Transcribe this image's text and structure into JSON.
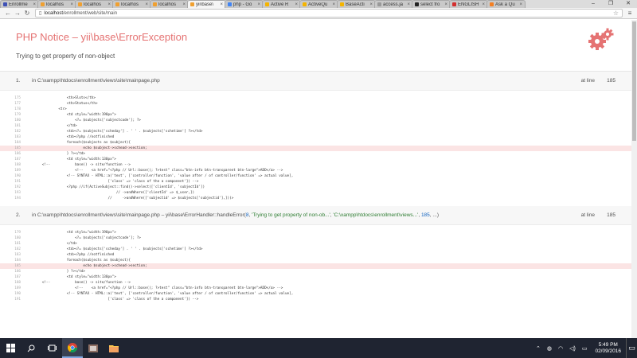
{
  "browser": {
    "tabs": [
      {
        "label": "Enrollme",
        "color": "#3f51b5",
        "active": false
      },
      {
        "label": "localhos",
        "color": "#f0a030",
        "active": false
      },
      {
        "label": "localhos",
        "color": "#f0a030",
        "active": false
      },
      {
        "label": "localhos",
        "color": "#f0a030",
        "active": false
      },
      {
        "label": "localhos",
        "color": "#f0a030",
        "active": false
      },
      {
        "label": "yii\\base\\",
        "color": "#f0a030",
        "active": true
      },
      {
        "label": "php - Go",
        "color": "#4285f4",
        "active": false
      },
      {
        "label": "Active R",
        "color": "#f5b400",
        "active": false
      },
      {
        "label": "ActiveQu",
        "color": "#f5b400",
        "active": false
      },
      {
        "label": "BaseActi",
        "color": "#f5b400",
        "active": false
      },
      {
        "label": "access.ja",
        "color": "#999999",
        "active": false
      },
      {
        "label": "select fro",
        "color": "#222222",
        "active": false
      },
      {
        "label": "ENGLISH",
        "color": "#d32f2f",
        "active": false
      },
      {
        "label": "Ask a Qu",
        "color": "#f48024",
        "active": false
      }
    ],
    "url_host": "localhost",
    "url_path": "/enrollment/web/site/main"
  },
  "error": {
    "type": "PHP Notice",
    "separator": " – ",
    "class": "yii\\base\\ErrorException",
    "message": "Trying to get property of non-object"
  },
  "calls": [
    {
      "num": "1.",
      "prefix": "in ",
      "file": "C:\\xampp\\htdocs\\enrollment\\views\\site\\mainpage.php",
      "fn": "",
      "args": [],
      "at_line_label": "at line",
      "line": "185",
      "code": [
        {
          "ln": "175",
          "text": "                    <th>Slots</th>",
          "err": false
        },
        {
          "ln": "177",
          "text": "                    <th>Status</th>",
          "err": false
        },
        {
          "ln": "178",
          "text": "                <tr>",
          "err": false
        },
        {
          "ln": "179",
          "text": "                    <td style=\"width:190px\">",
          "err": false
        },
        {
          "ln": "180",
          "text": "                        <?= $subjects['subjectcode']; ?>",
          "err": false
        },
        {
          "ln": "181",
          "text": "                    </td>",
          "err": false
        },
        {
          "ln": "182",
          "text": "                    <td><?= $subjects['scheday'] . ' ' . $subjects['schetime'] ?></td>",
          "err": false
        },
        {
          "ln": "183",
          "text": "                    <td><?php //notfinished",
          "err": false
        },
        {
          "ln": "184",
          "text": "                    foreach($subjects as $subject){",
          "err": false
        },
        {
          "ln": "185",
          "text": "                            echo $subject->schead->section;",
          "err": true
        },
        {
          "ln": "186",
          "text": "                    } ?></td>",
          "err": false
        },
        {
          "ln": "187",
          "text": "                    <td style=\"width:130px\">",
          "err": false
        },
        {
          "ln": "188",
          "text": "        <!--            base() -> site/function -->",
          "err": false
        },
        {
          "ln": "189",
          "text": "                        <!--    <a href=\"<?php // Url::base(); ?>test\" class=\"btn-info btn-transparent btn-large\">ADD</a> -->",
          "err": false
        },
        {
          "ln": "190",
          "text": "                    <!-- SYNTAX - HTML::a('text', ['controller/function', 'value after / of controller/function' => actual value],",
          "err": false
        },
        {
          "ln": "191",
          "text": "                                        ['class' => 'class of the a component']) -->",
          "err": false
        },
        {
          "ln": "192",
          "text": "                    <?php //if(ActiveSubject::find()->select(['clientId', 'subjectId'])",
          "err": false
        },
        {
          "ln": "193",
          "text": "                                            // ->andWhere(['clientId' => $_user,])",
          "err": false
        },
        {
          "ln": "194",
          "text": "                                        //     ->andWhere(['subjectid' => $subjects['subjectid'],]))>",
          "err": false
        }
      ]
    },
    {
      "num": "2.",
      "prefix": "in ",
      "file": "C:\\xampp\\htdocs\\enrollment\\views\\site\\mainpage.php",
      "fn": " – yii\\base\\ErrorHandler::handleError(",
      "args": [
        {
          "text": "8",
          "kind": "num"
        },
        {
          "text": ", ",
          "kind": "plain"
        },
        {
          "text": "'Trying to get property of non-ob...'",
          "kind": "str"
        },
        {
          "text": ", ",
          "kind": "plain"
        },
        {
          "text": "'C:\\xampp\\htdocs\\enrollment\\views...'",
          "kind": "str"
        },
        {
          "text": ", ",
          "kind": "plain"
        },
        {
          "text": "185",
          "kind": "num"
        },
        {
          "text": ", ...)",
          "kind": "plain"
        }
      ],
      "at_line_label": "at line",
      "line": "185",
      "code": [
        {
          "ln": "179",
          "text": "                    <td style=\"width:190px\">",
          "err": false
        },
        {
          "ln": "180",
          "text": "                        <?= $subjects['subjectcode']; ?>",
          "err": false
        },
        {
          "ln": "181",
          "text": "                    </td>",
          "err": false
        },
        {
          "ln": "182",
          "text": "                    <td><?= $subjects['scheday'] . ' ' . $subjects['schetime'] ?></td>",
          "err": false
        },
        {
          "ln": "183",
          "text": "                    <td><?php //notfinished",
          "err": false
        },
        {
          "ln": "184",
          "text": "                    foreach($subjects as $subject){",
          "err": false
        },
        {
          "ln": "185",
          "text": "                            echo $subject->schead->section;",
          "err": true
        },
        {
          "ln": "186",
          "text": "                    } ?></td>",
          "err": false
        },
        {
          "ln": "187",
          "text": "                    <td style=\"width:130px\">",
          "err": false
        },
        {
          "ln": "188",
          "text": "        <!--            base() -> site/function -->",
          "err": false
        },
        {
          "ln": "189",
          "text": "                        <!--    <a href=\"<?php // Url::base(); ?>test\" class=\"btn-info btn-transparent btn-large\">ADD</a> -->",
          "err": false
        },
        {
          "ln": "190",
          "text": "                    <!-- SYNTAX - HTML::a('text', ['controller/function', 'value after / of controller/function' => actual value],",
          "err": false
        },
        {
          "ln": "191",
          "text": "                                        ['class' => 'class of the a component']) -->",
          "err": false
        }
      ]
    }
  ],
  "taskbar": {
    "time": "5:49 PM",
    "date": "02/09/2016"
  }
}
